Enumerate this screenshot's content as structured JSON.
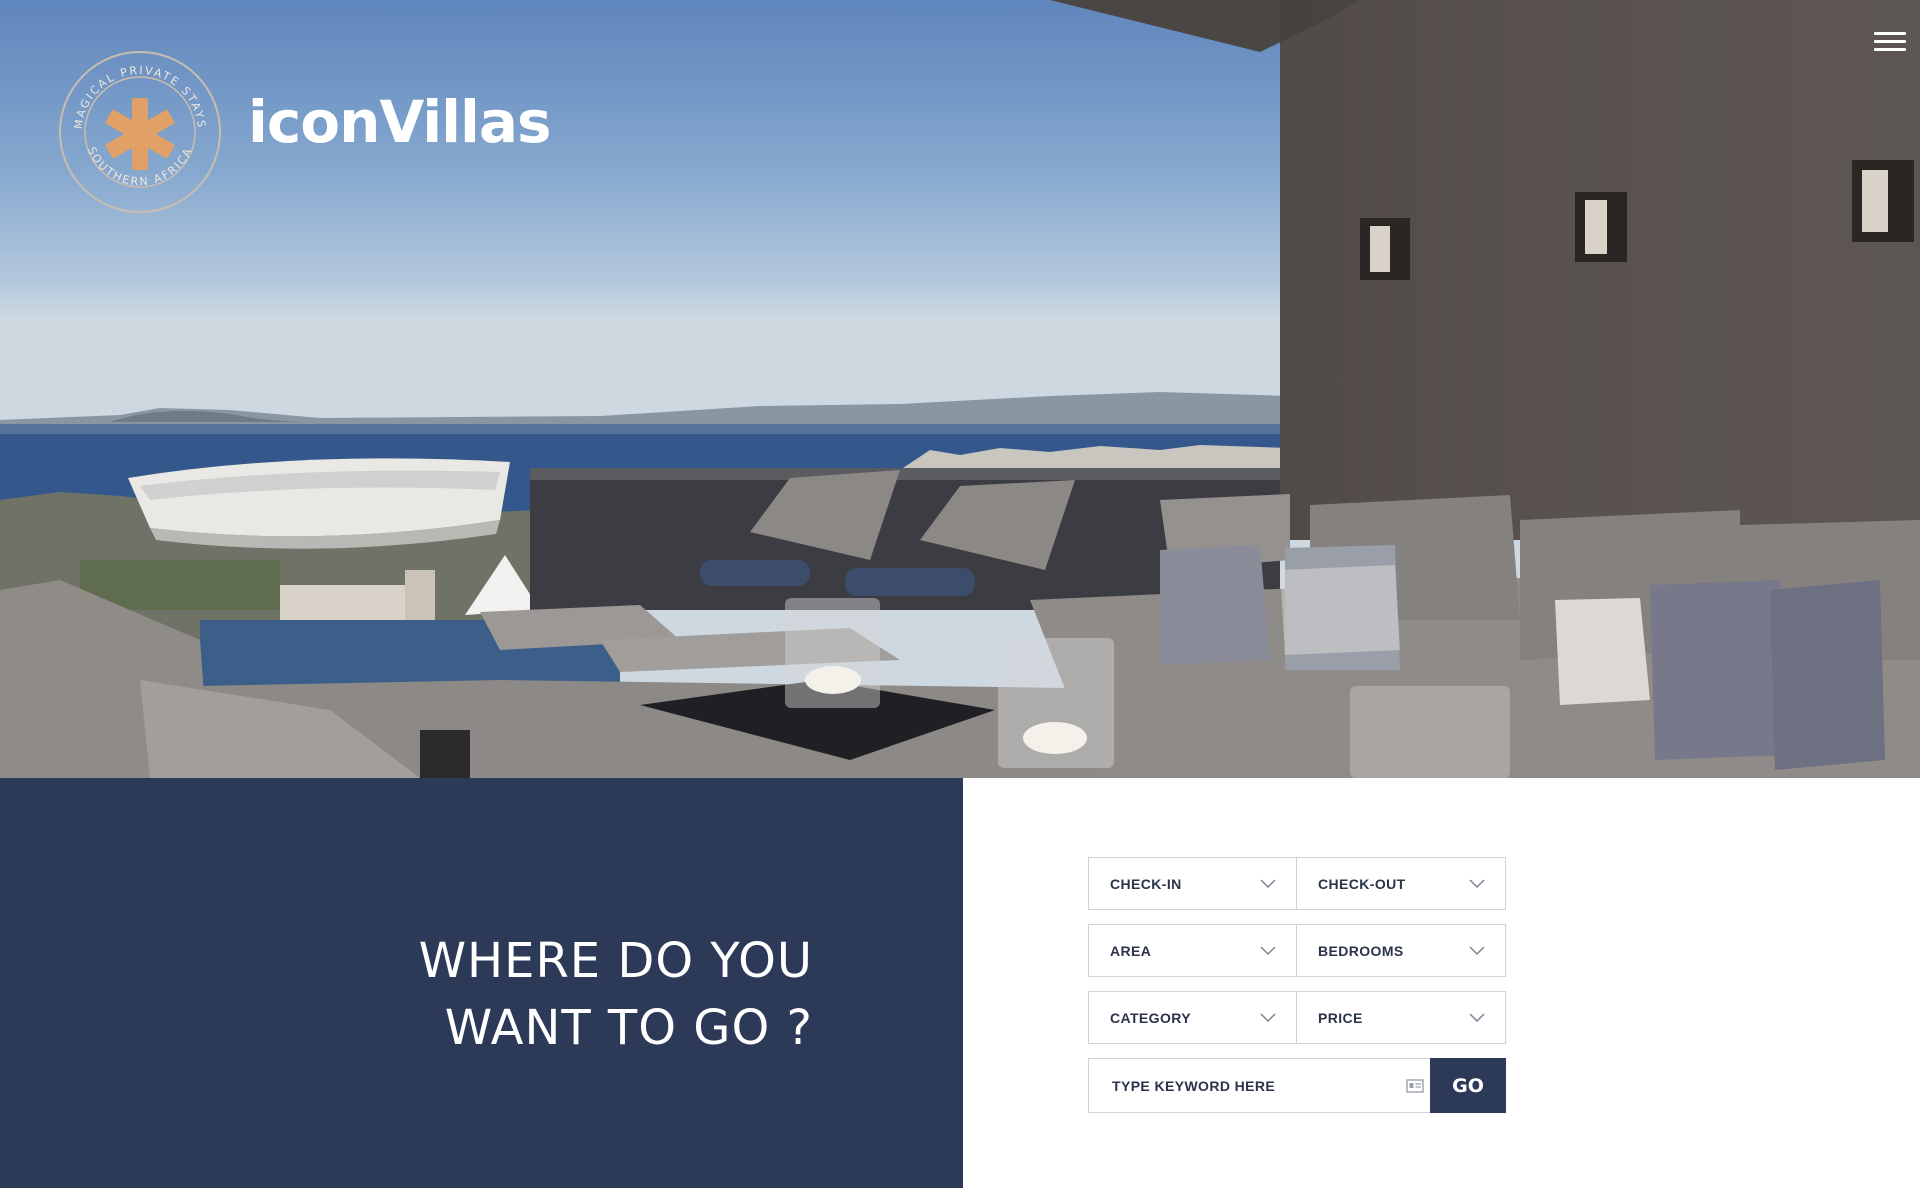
{
  "brand": {
    "name": "iconVillas",
    "emblem_text_top": "MAGICAL PRIVATE STAYS",
    "emblem_text_bottom": "SOUTHERN AFRICA",
    "emblem_icon": "asterisk-icon",
    "accent_color": "#e0a066"
  },
  "header": {
    "menu_icon": "hamburger-menu-icon"
  },
  "hero": {
    "image": "rooftop terrace with lounge sofas and ocean stadium view"
  },
  "headline": {
    "line1": "WHERE DO YOU",
    "line2": "WANT TO GO ?"
  },
  "search": {
    "checkin": "CHECK-IN",
    "checkout": "CHECK-OUT",
    "area": "AREA",
    "bedrooms": "BEDROOMS",
    "category": "CATEGORY",
    "price": "PRICE",
    "keyword_placeholder": "TYPE KEYWORD HERE",
    "go_label": "GO"
  },
  "colors": {
    "navy": "#2d3a57",
    "border": "#cfd3d8",
    "text": "#2a3348"
  }
}
